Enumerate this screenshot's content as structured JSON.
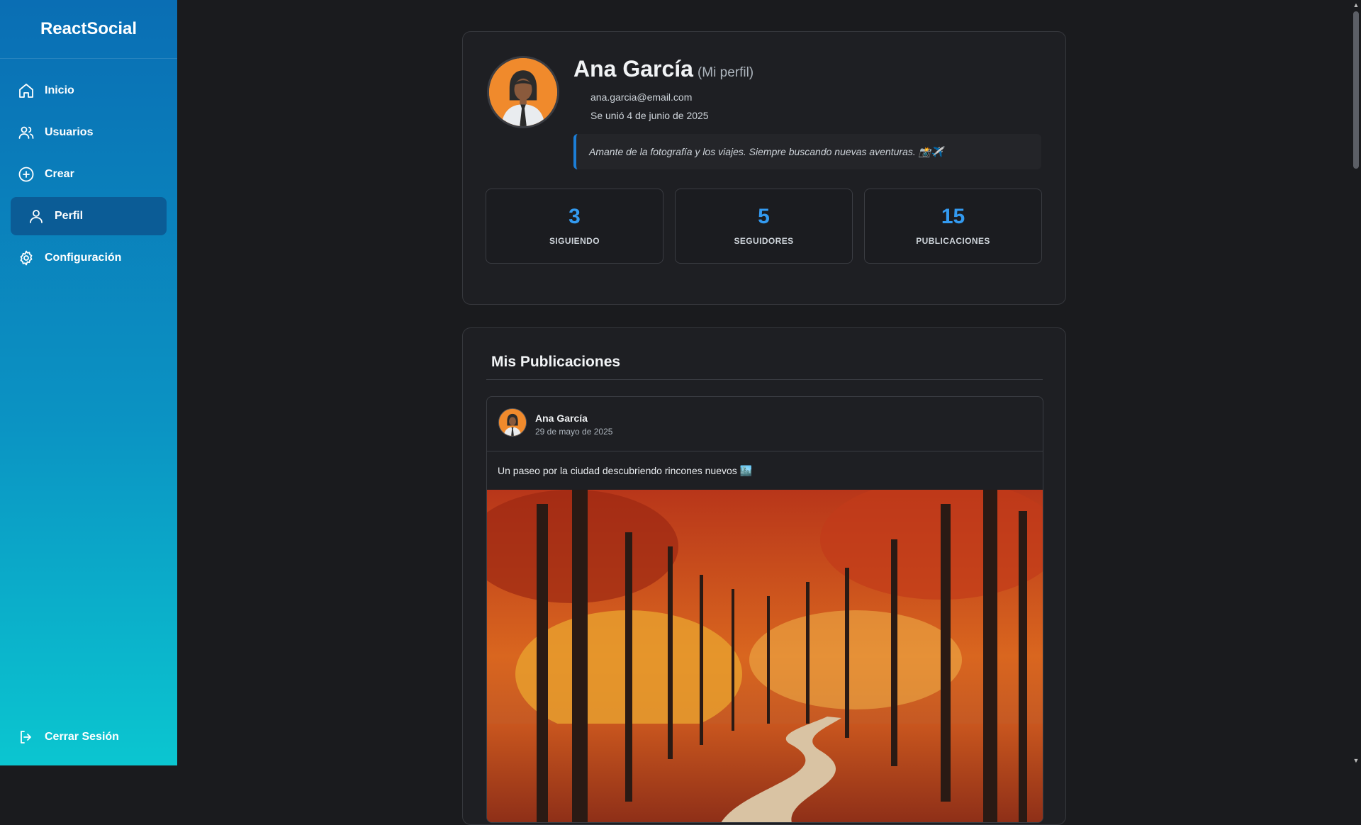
{
  "app": {
    "brand": "ReactSocial"
  },
  "sidebar": {
    "items": [
      {
        "label": "Inicio",
        "icon": "home-icon"
      },
      {
        "label": "Usuarios",
        "icon": "users-icon"
      },
      {
        "label": "Crear",
        "icon": "plus-circle-icon"
      },
      {
        "label": "Perfil",
        "icon": "user-icon",
        "active": true
      },
      {
        "label": "Configuración",
        "icon": "gear-icon"
      }
    ],
    "logout": "Cerrar Sesión"
  },
  "profile": {
    "name": "Ana García",
    "mine": "(Mi perfil)",
    "email": "ana.garcia@email.com",
    "joined": "Se unió 4 de junio de 2025",
    "bio": "Amante de la fotografía y los viajes. Siempre buscando nuevas aventuras. 📸✈️",
    "stats": [
      {
        "value": "3",
        "label": "SIGUIENDO"
      },
      {
        "value": "5",
        "label": "SEGUIDORES"
      },
      {
        "value": "15",
        "label": "PUBLICACIONES"
      }
    ]
  },
  "posts": {
    "title": "Mis Publicaciones",
    "items": [
      {
        "author": "Ana García",
        "date": "29 de mayo de 2025",
        "text": "Un paseo por la ciudad descubriendo rincones nuevos 🏙️"
      }
    ]
  },
  "colors": {
    "accent": "#339af0",
    "sidebar_top": "#0a6eb4",
    "sidebar_bottom": "#0bc6d0",
    "avatar_bg": "#f08a2c"
  }
}
